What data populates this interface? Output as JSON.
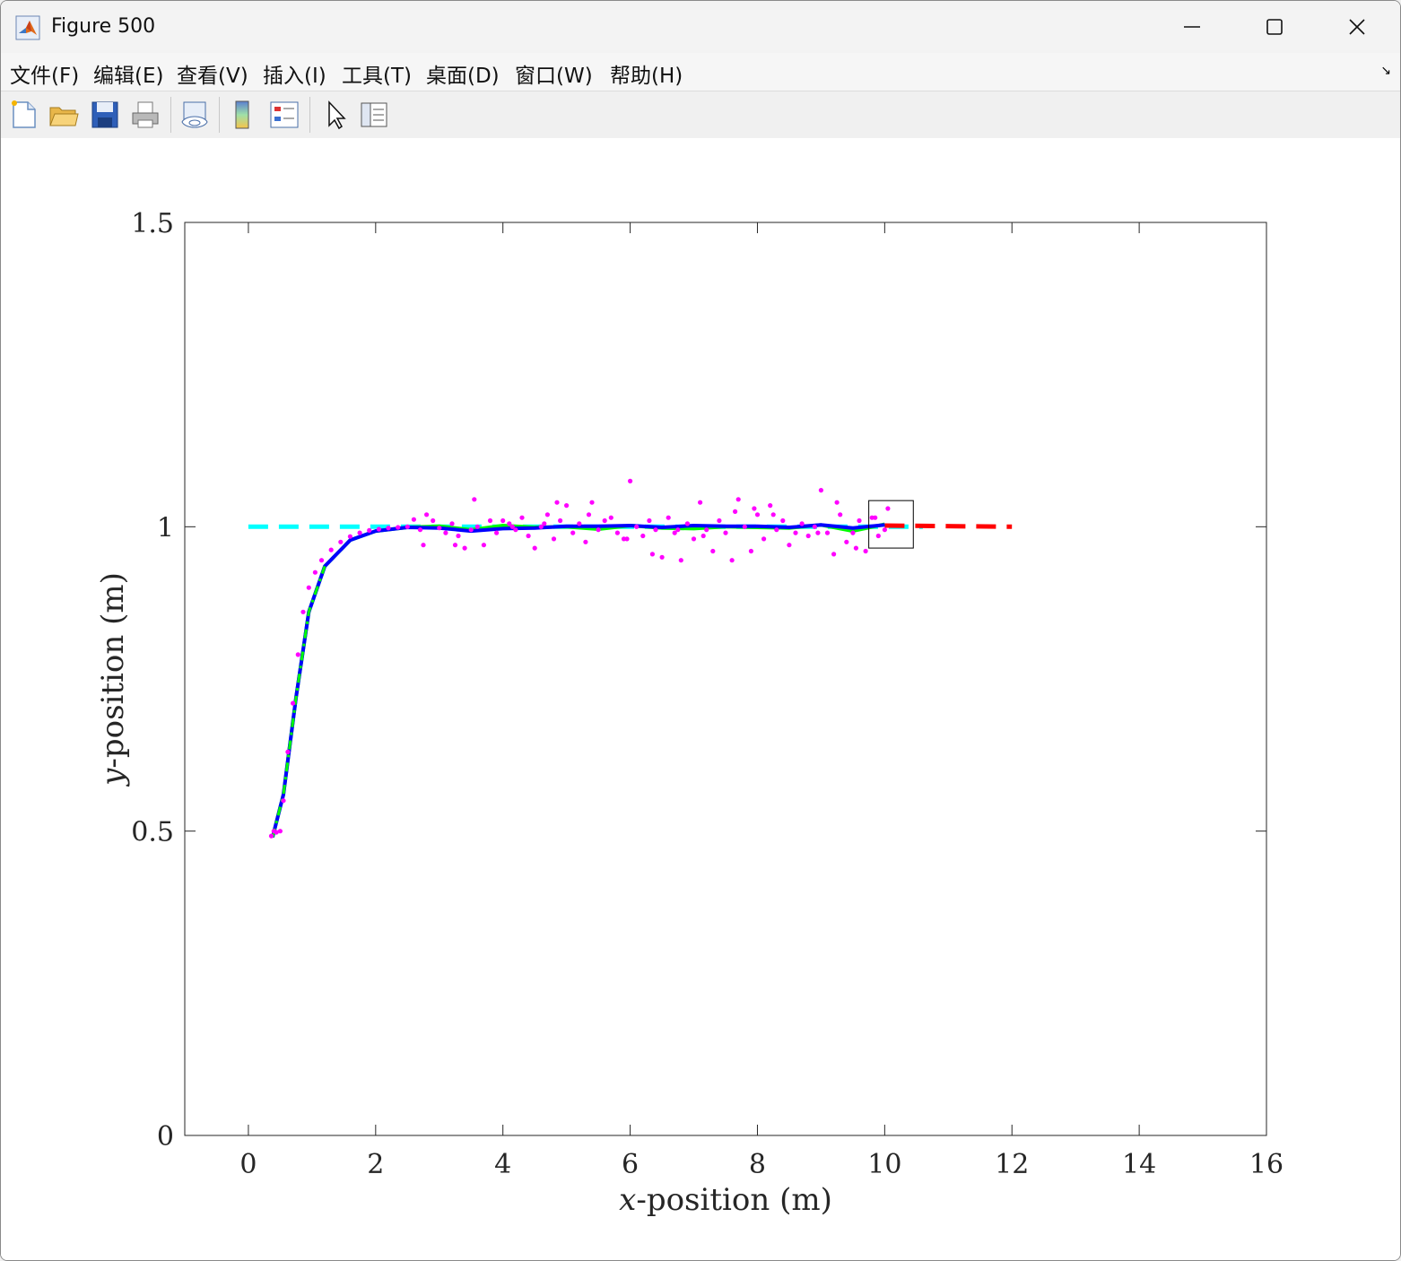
{
  "window": {
    "title": "Figure 500",
    "minimize_glyph": "—",
    "maximize_glyph": "☐",
    "close_glyph": "✕"
  },
  "menu": [
    {
      "label": "文件(F)"
    },
    {
      "label": "编辑(E)"
    },
    {
      "label": "查看(V)"
    },
    {
      "label": "插入(I)"
    },
    {
      "label": "工具(T)"
    },
    {
      "label": "桌面(D)"
    },
    {
      "label": "窗口(W)"
    },
    {
      "label": "帮助(H)"
    }
  ],
  "toolbar": [
    {
      "icon": "new-figure-icon"
    },
    {
      "icon": "open-file-icon"
    },
    {
      "icon": "save-icon"
    },
    {
      "icon": "print-icon"
    },
    {
      "icon": "link-plot-icon"
    },
    {
      "icon": "colorbar-icon"
    },
    {
      "icon": "legend-icon"
    },
    {
      "icon": "edit-plot-pointer-icon"
    },
    {
      "icon": "property-inspector-icon"
    }
  ],
  "colors": {
    "reference": "#00ffff",
    "estimate": "#0000ff",
    "smoothed": "#00ff00",
    "measurements": "#ff00ff",
    "prediction": "#ff0000",
    "axes": "#262626"
  },
  "chart_data": {
    "type": "line",
    "xlabel_var": "x",
    "xlabel_rest": "-position (m)",
    "ylabel_var": "y",
    "ylabel_rest": "-position (m)",
    "xlim": [
      -1,
      16
    ],
    "ylim": [
      0,
      1.5
    ],
    "xticks": [
      0,
      2,
      4,
      6,
      8,
      10,
      12,
      14,
      16
    ],
    "yticks": [
      0,
      0.5,
      1,
      1.5
    ],
    "xtick_labels": [
      "0",
      "2",
      "4",
      "6",
      "8",
      "10",
      "12",
      "14",
      "16"
    ],
    "ytick_labels": [
      "0",
      "0.5",
      "1",
      "1.5"
    ],
    "grid": false,
    "series": [
      {
        "style": "dashed",
        "color": "#00ffff",
        "x": [
          0,
          10.6
        ],
        "y": [
          1,
          1
        ]
      },
      {
        "style": "dashed",
        "color": "#ff0000",
        "x": [
          10,
          12
        ],
        "y": [
          1.002,
          1
        ]
      },
      {
        "style": "solid",
        "color": "#00ff00",
        "x": [
          0.38,
          0.55,
          0.75,
          0.95,
          1.2,
          1.6,
          2.0,
          2.5,
          3.0,
          3.5,
          4.0,
          4.5,
          5.0,
          5.5,
          6.0,
          6.5,
          7.0,
          7.5,
          8.0,
          8.5,
          9.0,
          9.5,
          10.0
        ],
        "y": [
          0.49,
          0.56,
          0.72,
          0.86,
          0.935,
          0.978,
          0.993,
          0.999,
          1.001,
          0.995,
          1.002,
          0.999,
          1.0,
          0.996,
          1.002,
          0.998,
          0.997,
          1.0,
          0.999,
          0.998,
          1.003,
          0.993,
          1.004
        ]
      },
      {
        "style": "solid",
        "color": "#0000ff",
        "x": [
          0.38,
          0.55,
          0.75,
          0.95,
          1.2,
          1.6,
          2.0,
          2.5,
          3.0,
          3.5,
          4.0,
          4.5,
          5.0,
          5.5,
          6.0,
          6.5,
          7.0,
          7.5,
          8.0,
          8.5,
          9.0,
          9.5,
          10.0
        ],
        "y": [
          0.49,
          0.56,
          0.72,
          0.86,
          0.935,
          0.978,
          0.993,
          0.999,
          0.998,
          0.993,
          0.997,
          0.998,
          1.001,
          1.001,
          1.002,
          0.999,
          1.002,
          1.001,
          1.001,
          0.999,
          1.003,
          0.998,
          1.003
        ]
      },
      {
        "style": "dashdot",
        "color": "#00ff00",
        "x": [
          0.38,
          0.55,
          0.75,
          0.95,
          1.2
        ],
        "y": [
          0.49,
          0.56,
          0.72,
          0.86,
          0.935
        ]
      }
    ],
    "measurements": {
      "color": "#ff00ff",
      "x": [
        0.36,
        0.4,
        0.44,
        0.5,
        0.55,
        0.62,
        0.7,
        0.78,
        0.86,
        0.95,
        1.05,
        1.15,
        1.3,
        1.45,
        1.6,
        1.75,
        1.9,
        2.05,
        2.2,
        2.35,
        2.5,
        2.6,
        2.7,
        2.8,
        2.9,
        3.0,
        3.1,
        3.2,
        3.3,
        3.4,
        3.5,
        3.6,
        3.7,
        3.8,
        3.9,
        4.0,
        4.1,
        4.2,
        4.3,
        4.4,
        4.5,
        4.6,
        4.7,
        4.8,
        4.9,
        5.0,
        5.1,
        5.2,
        5.3,
        5.4,
        5.5,
        5.6,
        5.7,
        5.8,
        5.9,
        6.0,
        6.1,
        6.2,
        6.3,
        6.4,
        6.5,
        6.6,
        6.7,
        6.8,
        6.9,
        7.0,
        7.1,
        7.2,
        7.3,
        7.4,
        7.5,
        7.6,
        7.7,
        7.8,
        7.9,
        8.0,
        8.1,
        8.2,
        8.3,
        8.4,
        8.5,
        8.6,
        8.7,
        8.8,
        8.9,
        9.0,
        9.1,
        9.2,
        9.3,
        9.4,
        9.5,
        9.6,
        9.7,
        9.8,
        9.9,
        10.0,
        10.05,
        2.75,
        3.55,
        4.15,
        4.65,
        5.35,
        5.95,
        6.75,
        7.15,
        7.65,
        8.25,
        8.95,
        9.25,
        9.85,
        3.25,
        4.85,
        6.35,
        7.95,
        9.55
      ],
      "y": [
        0.492,
        0.5,
        0.498,
        0.5,
        0.55,
        0.63,
        0.71,
        0.79,
        0.86,
        0.9,
        0.925,
        0.945,
        0.962,
        0.975,
        0.984,
        0.99,
        0.994,
        0.996,
        0.998,
        0.999,
        1.0,
        1.012,
        0.995,
        1.02,
        1.01,
        0.998,
        0.99,
        1.005,
        0.985,
        0.965,
        0.995,
        1.0,
        0.97,
        1.01,
        0.99,
        1.01,
        1.005,
        0.995,
        1.015,
        0.985,
        0.965,
        1.0,
        1.02,
        0.98,
        1.01,
        1.035,
        0.99,
        1.005,
        0.975,
        1.04,
        0.995,
        1.01,
        1.015,
        0.99,
        0.98,
        1.075,
        1.0,
        0.985,
        1.01,
        0.995,
        0.95,
        1.015,
        0.99,
        0.945,
        1.005,
        0.98,
        1.04,
        0.995,
        0.96,
        1.01,
        0.99,
        0.945,
        1.045,
        1.0,
        0.96,
        1.02,
        0.98,
        1.035,
        0.995,
        1.01,
        0.97,
        0.99,
        1.005,
        0.985,
        1.0,
        1.06,
        0.99,
        0.955,
        1.02,
        0.975,
        0.99,
        1.01,
        0.96,
        1.015,
        0.985,
        0.995,
        1.03,
        0.97,
        1.045,
        1.0,
        1.005,
        1.02,
        0.98,
        0.995,
        0.985,
        1.025,
        1.02,
        0.99,
        1.04,
        1.015,
        0.97,
        1.04,
        0.955,
        1.03,
        0.965,
        0.975,
        1.01,
        1.02,
        0.995
      ]
    },
    "zoom_box": {
      "x": [
        9.75,
        10.45
      ],
      "y": [
        0.965,
        1.043
      ]
    }
  }
}
